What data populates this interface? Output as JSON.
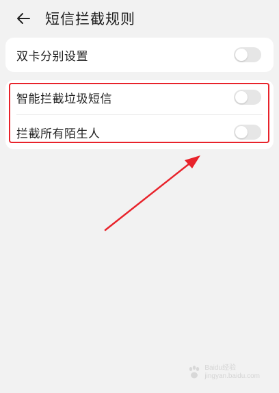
{
  "header": {
    "title": "短信拦截规则"
  },
  "settings": {
    "dual_sim": {
      "label": "双卡分别设置",
      "enabled": false
    },
    "smart_block": {
      "label": "智能拦截垃圾短信",
      "enabled": false
    },
    "block_strangers": {
      "label": "拦截所有陌生人",
      "enabled": false
    }
  },
  "annotation": {
    "highlight_color": "#e8232b",
    "arrow_color": "#e8232b"
  },
  "watermark": {
    "brand": "Baidu经验",
    "site": "jingyan.baidu.com"
  },
  "colors": {
    "background": "#f2f2f2",
    "card": "#ffffff",
    "toggle_off": "#e6e6e6"
  }
}
